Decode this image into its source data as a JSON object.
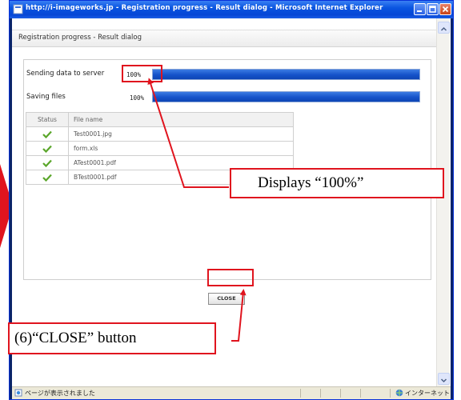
{
  "window": {
    "title": "http://i-imageworks.jp - Registration progress - Result dialog - Microsoft Internet Explorer"
  },
  "dialog": {
    "header": "Registration progress - Result dialog",
    "progress": [
      {
        "label": "Sending data to server",
        "percent_text": "100%",
        "percent": 100
      },
      {
        "label": "Saving files",
        "percent_text": "100%",
        "percent": 100
      }
    ],
    "table": {
      "columns": [
        "Status",
        "File name"
      ],
      "rows": [
        {
          "status": "check-icon",
          "file": "Test0001.jpg"
        },
        {
          "status": "check-icon",
          "file": "form.xls"
        },
        {
          "status": "check-icon",
          "file": "ATest0001.pdf"
        },
        {
          "status": "check-icon",
          "file": "BTest0001.pdf"
        }
      ]
    },
    "close_label": "CLOSE"
  },
  "statusbar": {
    "text": "ページが表示されました",
    "zone": "インターネット"
  },
  "annotations": {
    "callout_1": "Displays “100%”",
    "callout_2": "(6)“CLOSE” button"
  },
  "colors": {
    "titlebar": "#0a55e0",
    "progress_fill": "#1552c9",
    "annotation_red": "#e0141e",
    "check_green": "#5aa62a"
  }
}
